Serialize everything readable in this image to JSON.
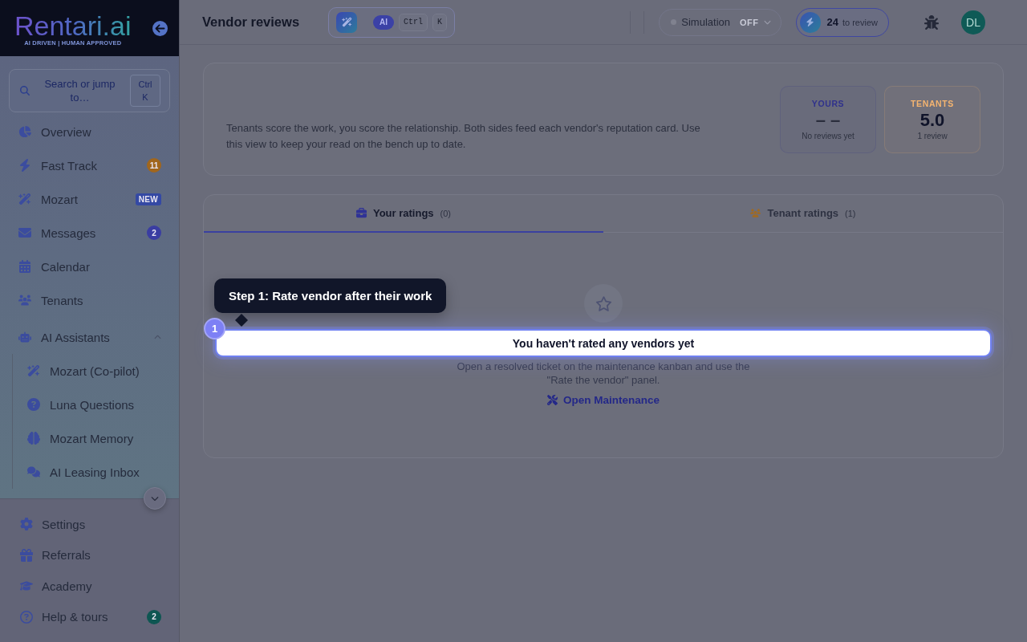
{
  "sidebar": {
    "logo": {
      "wordmark": "Rentari.ai",
      "tagline": "AI DRIVEN | HUMAN APPROVED"
    },
    "search": {
      "placeholder": "Search or jump to…",
      "shortcut": "Ctrl K"
    },
    "nav_items": [
      {
        "label": "Overview",
        "selected": false
      },
      {
        "label": "Fast Track",
        "selected": false,
        "badge": {
          "kind": "count",
          "text": "11",
          "color": "#a1661c"
        }
      },
      {
        "label": "Mozart",
        "selected": false,
        "badge": {
          "kind": "tag",
          "text": "NEW",
          "color": "#3449a4"
        }
      },
      {
        "label": "Messages",
        "selected": false,
        "badge": {
          "kind": "count",
          "text": "2",
          "color": "#3a3da2"
        }
      },
      {
        "label": "Calendar",
        "selected": false
      },
      {
        "label": "Tenants",
        "selected": false
      }
    ],
    "ai_group": {
      "label": "AI Assistants",
      "expanded": true,
      "children": [
        {
          "label": "Mozart (Co-pilot)",
          "selected": false
        },
        {
          "label": "Luna Questions",
          "selected": false
        },
        {
          "label": "Mozart Memory",
          "selected": false
        },
        {
          "label": "AI Leasing Inbox",
          "selected": false
        }
      ]
    },
    "footer_items": [
      {
        "label": "Settings",
        "selected": false
      },
      {
        "label": "Referrals",
        "selected": false
      },
      {
        "label": "Academy",
        "selected": false
      },
      {
        "label": "Help & tours",
        "selected": false,
        "badge": {
          "kind": "count",
          "text": "2",
          "color": "#0e5652"
        }
      }
    ]
  },
  "header": {
    "title": "Vendor reviews",
    "ai_bar": {
      "badge": "AI",
      "keys": [
        "Ctrl",
        "K"
      ]
    },
    "simulation": {
      "label": "Simulation",
      "state": "OFF",
      "on": false
    },
    "review": {
      "count": "24",
      "label": "to review"
    },
    "avatar": {
      "initials": "DL"
    }
  },
  "summary": {
    "description": "Tenants score the work, you score the relationship. Both sides feed each vendor's reputation card. Use this view to keep your read on the bench up to date.",
    "stats": [
      {
        "label": "YOURS",
        "value": "– –",
        "caption": "No reviews yet",
        "color": "#2f318c",
        "muted": true
      },
      {
        "label": "TENANTS",
        "value": "5.0",
        "caption": "1 review",
        "color": "#f4b470",
        "muted": false
      }
    ]
  },
  "ratings": {
    "tabs": [
      {
        "label": "Your ratings",
        "count": "(0)",
        "selected": true,
        "color": "#2f3296"
      },
      {
        "label": "Tenant ratings",
        "count": "(1)",
        "selected": false,
        "color": "#a06a22"
      }
    ],
    "empty_state": {
      "title": "You haven't rated any vendors yet",
      "text": "Open a resolved ticket on the maintenance kanban and use the \"Rate the vendor\" panel.",
      "link": "Open Maintenance"
    },
    "tour": {
      "step": "1",
      "tooltip": "Step 1: Rate vendor after their work"
    }
  }
}
